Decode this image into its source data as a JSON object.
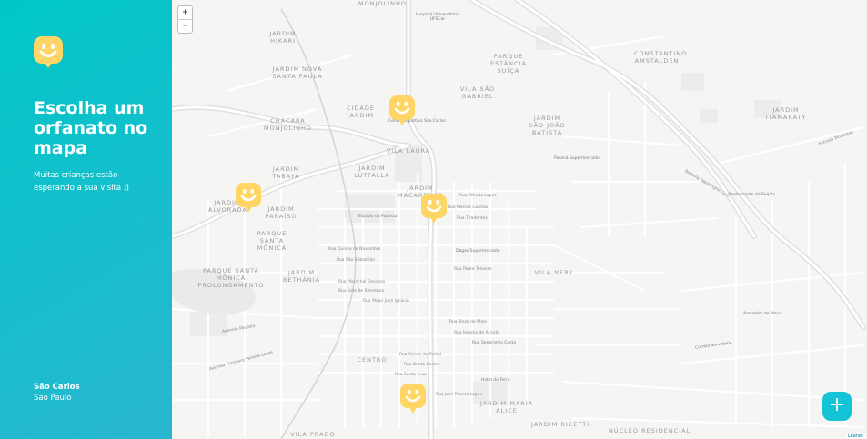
{
  "sidebar": {
    "title": "Escolha um orfanato no mapa",
    "subtitle": "Muitas crianças estão esperando a sua visita :)",
    "city": "São Carlos",
    "state": "São Paulo"
  },
  "map": {
    "zoom_in": "+",
    "zoom_out": "−",
    "attribution": "Leaflet",
    "create_button": "+",
    "neighborhoods": [
      "JARDIM HIKARI",
      "JARDIM NOVA SANTA PAULA",
      "PARQUE ESTÂNCIA SUÍÇA",
      "CONSTANTINO AMSTALDEN",
      "CIDADE JARDIM",
      "VILA SÃO GABRIEL",
      "JARDIM SÃO JOÃO BATISTA",
      "JARDIM ITAMARATY",
      "CHÁCARA MONJOLINHO",
      "VILA LAURA",
      "JARDIM TABAYÁ",
      "JARDIM LUTFALLA",
      "JARDIM ALVORADA",
      "JARDIM PARAÍSO",
      "JARDIM MACARENKO",
      "PARQUE SANTA MÔNICA",
      "PARQUE SANTA MÔNICA PROLONGAMENTO",
      "JARDIM BETHÂNIA",
      "VILA NERY",
      "CENTRO",
      "JARDIM MARIA ALICE",
      "JARDIM RICETTI",
      "NÚCLEO RESIDENCIAL",
      "VILA PRADO",
      "MONJOLINHO"
    ],
    "streets": [
      "Rua Alfredo Lopes",
      "Rua Marcos Cunhas",
      "Rua Tiradentes",
      "Rua Episcopal",
      "Rua Quinze de Novembro",
      "Rua São Sebastião",
      "Rua Padre Teixeira",
      "Rua Marechal Deodoro",
      "Rua Sete de Setembro",
      "Rua Major José Ignácio",
      "Rua Treze de Maio",
      "Rua Jesuíno de Arruda",
      "Rua Conde do Pinhal",
      "Rua Bento Carlos",
      "Rua Santa Cruz",
      "Rua José Pereira Lopes",
      "Avenida São Carlos",
      "Rodovia Washington Luís",
      "Estrada Municipal",
      "Avenida Francisco Pereira Lopes",
      "Avenida Paulista",
      "Rua Dona Alexandrina",
      "Avenida Trabalhador Sãocarlense",
      "Rua Nove de Julho",
      "Rua Salles",
      "Rua Dom Pedro II",
      "Rua Riachuelo",
      "Rua Dr. Carlos Botelho",
      "Rua Episcopal",
      "Rua São Joaquim",
      "Rua Jardim Paraíso",
      "Rua Sete de Setembro",
      "Rua Quatorze de Dezembro",
      "Rua Quinze de Novembro",
      "Rua Major Manoel Antônio de Mattos",
      "Rua Araújo Cunha"
    ],
    "pois": [
      "Hospital Universitário UFSCar",
      "Centro Esportivo São Carlos",
      "Pão de Açúcar",
      "Paraná Supermercado",
      "Restaurante do Beijola",
      "Dagos Supermercado",
      "Estádio do Paulista",
      "Armazém de Maria",
      "Hotel do Terra",
      "Rua José Pereira Lopes",
      "Rua Jesuíno de Arruda",
      "Rua Semiramis Costa",
      "Correio Sorveteria",
      "Rua Rio Branco"
    ]
  }
}
